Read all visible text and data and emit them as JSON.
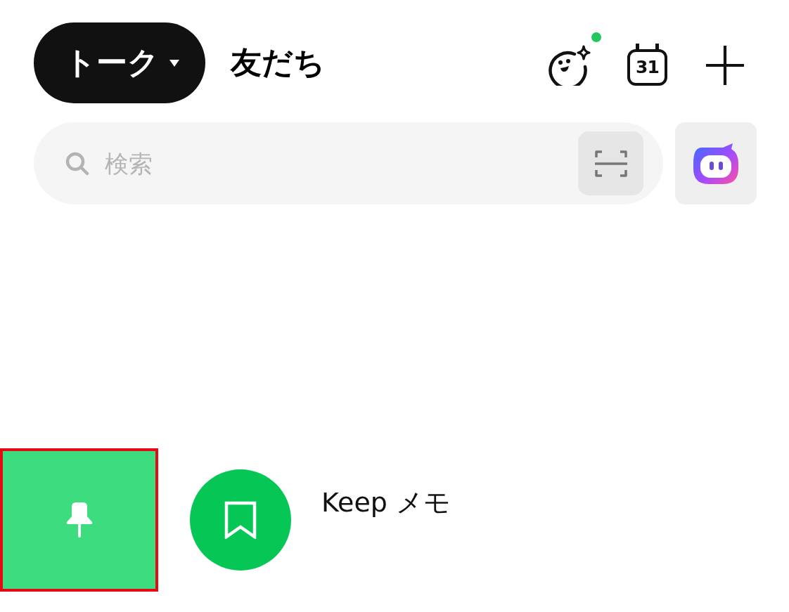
{
  "header": {
    "tabs": [
      {
        "label": "トーク",
        "selected": true,
        "dropdown": true
      },
      {
        "label": "友だち",
        "selected": false,
        "dropdown": false
      }
    ],
    "actions": [
      {
        "kind": "character",
        "badge": true
      },
      {
        "kind": "calendar",
        "label": "31"
      },
      {
        "kind": "add"
      }
    ]
  },
  "search": {
    "placeholder": "検索"
  },
  "chats": [
    {
      "name": "Keep メモ",
      "swipe_actions": [
        {
          "kind": "pin",
          "highlighted": true
        }
      ]
    }
  ]
}
